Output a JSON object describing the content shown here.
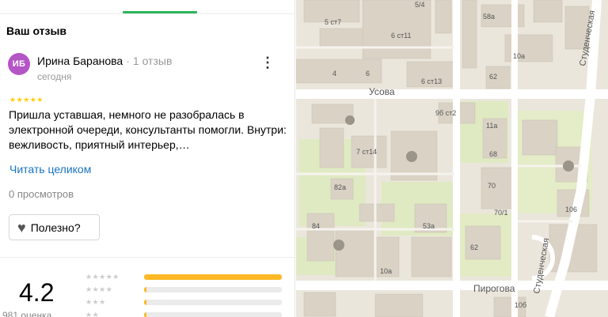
{
  "review_panel": {
    "section_title": "Ваш отзыв",
    "review": {
      "avatar_initials": "ИБ",
      "avatar_color": "#b455c6",
      "author_name": "Ирина Баранова",
      "author_reviews": "1 отзыв",
      "date": "сегодня",
      "rating": 5,
      "stars": "★★★★★",
      "text": "Пришла уставшая, немного не разобралась в электронной очереди, консультанты помогли. Внутри: вежливость, приятный интерьер,…",
      "read_more": "Читать целиком",
      "views": "0 просмотров",
      "useful_label": "Полезно?"
    },
    "rating_summary": {
      "score": "4.2",
      "count_label": "981 оценка",
      "histogram": [
        {
          "stars": "★★★★★",
          "share": 1.0
        },
        {
          "stars": "★★★★",
          "share": 0.015
        },
        {
          "stars": "★★★",
          "share": 0.015
        },
        {
          "stars": "★★",
          "share": 0.015
        }
      ]
    }
  },
  "map": {
    "streets": [
      "Усова",
      "Пирогова",
      "Студенческая",
      "Студенческая"
    ],
    "building_labels": [
      "5/4",
      "58а",
      "5 ст7",
      "6 ст11",
      "4",
      "6",
      "10а",
      "62",
      "6 ст13",
      "9б ст2",
      "11а",
      "7 ст14",
      "68",
      "82а",
      "70",
      "106",
      "70/1",
      "53а",
      "84",
      "10а",
      "62",
      "10б"
    ]
  }
}
